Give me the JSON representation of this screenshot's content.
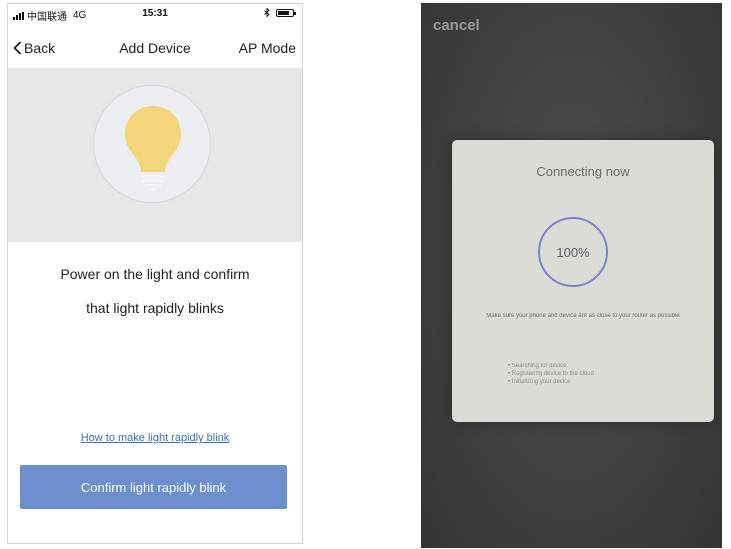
{
  "left_screen": {
    "status_bar": {
      "carrier": "中国联通",
      "network": "4G",
      "time": "15:31",
      "icons": [
        "signal-icon",
        "bluetooth-icon",
        "battery-icon"
      ]
    },
    "nav": {
      "back_label": "Back",
      "title": "Add Device",
      "right_action": "AP Mode"
    },
    "hero": {
      "icon": "light-bulb-icon",
      "bulb_color": "#f3d67a"
    },
    "instruction_line1": "Power on the light and confirm",
    "instruction_line2": "that light rapidly blinks",
    "help_link": "How to make light rapidly blink",
    "confirm_button": "Confirm light rapidly blink",
    "colors": {
      "accent": "#6b8fcf",
      "link": "#3d6fb8",
      "hero_bg": "#e7e7e7"
    }
  },
  "right_screen": {
    "cancel_label": "cancel",
    "card": {
      "title": "Connecting now",
      "progress_label": "100%",
      "progress": 1.0,
      "hint": "Make sure your phone and device are as close to your router as possible",
      "steps": [
        "Searching for device",
        "Registering device to the cloud",
        "Initializing your device"
      ]
    },
    "colors": {
      "ring": "#7e7fd0",
      "card_bg": "#dcdcd6",
      "screen_bg": "#3f413f"
    }
  }
}
